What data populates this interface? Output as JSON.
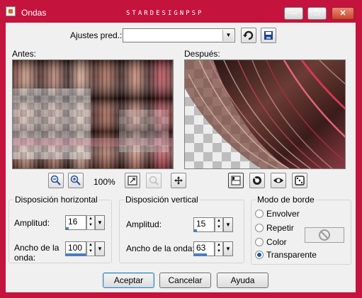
{
  "window": {
    "title": "Ondas",
    "brand": "STARDESIGNPSP",
    "controls": {
      "minimize": "—",
      "maximize": "□",
      "close": "✕"
    }
  },
  "preset": {
    "label": "Ajustes pred.:",
    "value": ""
  },
  "previews": {
    "before_label": "Antes:",
    "after_label": "Después:"
  },
  "toolbar": {
    "zoom_label": "100%",
    "icons": [
      "zoom-out-icon",
      "zoom-in-icon",
      "fit-icon",
      "zoom-disabled-icon",
      "pan-icon",
      "layout-icon",
      "randomize-icon",
      "eye-icon",
      "dice-icon"
    ]
  },
  "horizontal": {
    "title": "Disposición horizontal",
    "amplitude_label": "Amplitud:",
    "amplitude_value": "16",
    "amplitude_fill": 0.16,
    "wavelength_label_1": "Ancho de la",
    "wavelength_label_2": "onda:",
    "wavelength_value": "100",
    "wavelength_fill": 1.0
  },
  "vertical": {
    "title": "Disposición vertical",
    "amplitude_label": "Amplitud:",
    "amplitude_value": "15",
    "amplitude_fill": 0.15,
    "wavelength_label": "Ancho de la onda:",
    "wavelength_value": "63",
    "wavelength_fill": 0.63
  },
  "edge_mode": {
    "title": "Modo de borde",
    "options": [
      "Envolver",
      "Repetir",
      "Color",
      "Transparente"
    ],
    "selected": "Transparente"
  },
  "buttons": {
    "ok": "Aceptar",
    "cancel": "Cancelar",
    "help": "Ayuda"
  },
  "colors": {
    "frame": "#c4133d",
    "dialog": "#f0f0f0",
    "accent": "#3c7fd6"
  }
}
